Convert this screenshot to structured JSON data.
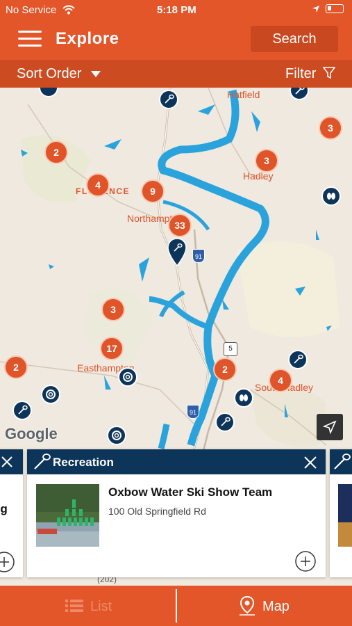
{
  "status_bar": {
    "carrier": "No Service",
    "time": "5:18 PM"
  },
  "header": {
    "title": "Explore",
    "search_label": "Search"
  },
  "sort_bar": {
    "sort_label": "Sort Order",
    "filter_label": "Filter"
  },
  "map": {
    "towns": [
      "Hatfield",
      "Hadley",
      "FLORENCE",
      "Northampton",
      "Easthampton",
      "South Hadley"
    ],
    "clusters": [
      "3",
      "2",
      "3",
      "4",
      "9",
      "33",
      "3",
      "17",
      "2",
      "2",
      "4"
    ],
    "route_shields": [
      "91",
      "5",
      "91"
    ],
    "road_label": "(202)",
    "google_logo": "Google"
  },
  "cards": {
    "left_partial_text": "ng",
    "main": {
      "category": "Recreation",
      "name": "Oxbow Water Ski Show Team",
      "address": "100 Old Springfield Rd"
    }
  },
  "tabs": {
    "list_label": "List",
    "map_label": "Map"
  },
  "colors": {
    "brand_orange": "#e2562a",
    "dark_orange": "#cd4b20",
    "navy": "#0d3459",
    "river": "#2aa3dd"
  }
}
